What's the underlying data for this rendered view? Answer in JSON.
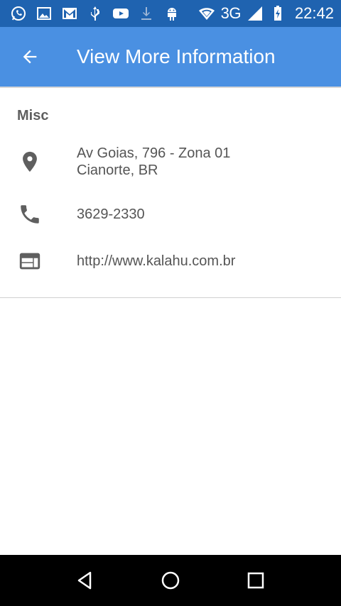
{
  "status_bar": {
    "left_icons": [
      "whatsapp-icon",
      "gallery-icon",
      "gmail-icon",
      "usb-icon",
      "youtube-icon",
      "download-icon",
      "android-icon"
    ],
    "network": "3G",
    "time": "22:42"
  },
  "app_bar": {
    "title": "View More Information",
    "back_icon": "arrow-back-icon"
  },
  "section": {
    "title": "Misc"
  },
  "info": {
    "address_line1": "Av Goias, 796 - Zona 01",
    "address_line2": "Cianorte, BR",
    "phone": "3629-2330",
    "website": "http://www.kalahu.com.br"
  },
  "colors": {
    "status_bar": "#1f63b0",
    "app_bar": "#4a90e2",
    "text_secondary": "#555555",
    "icon": "#5f5f5f"
  }
}
